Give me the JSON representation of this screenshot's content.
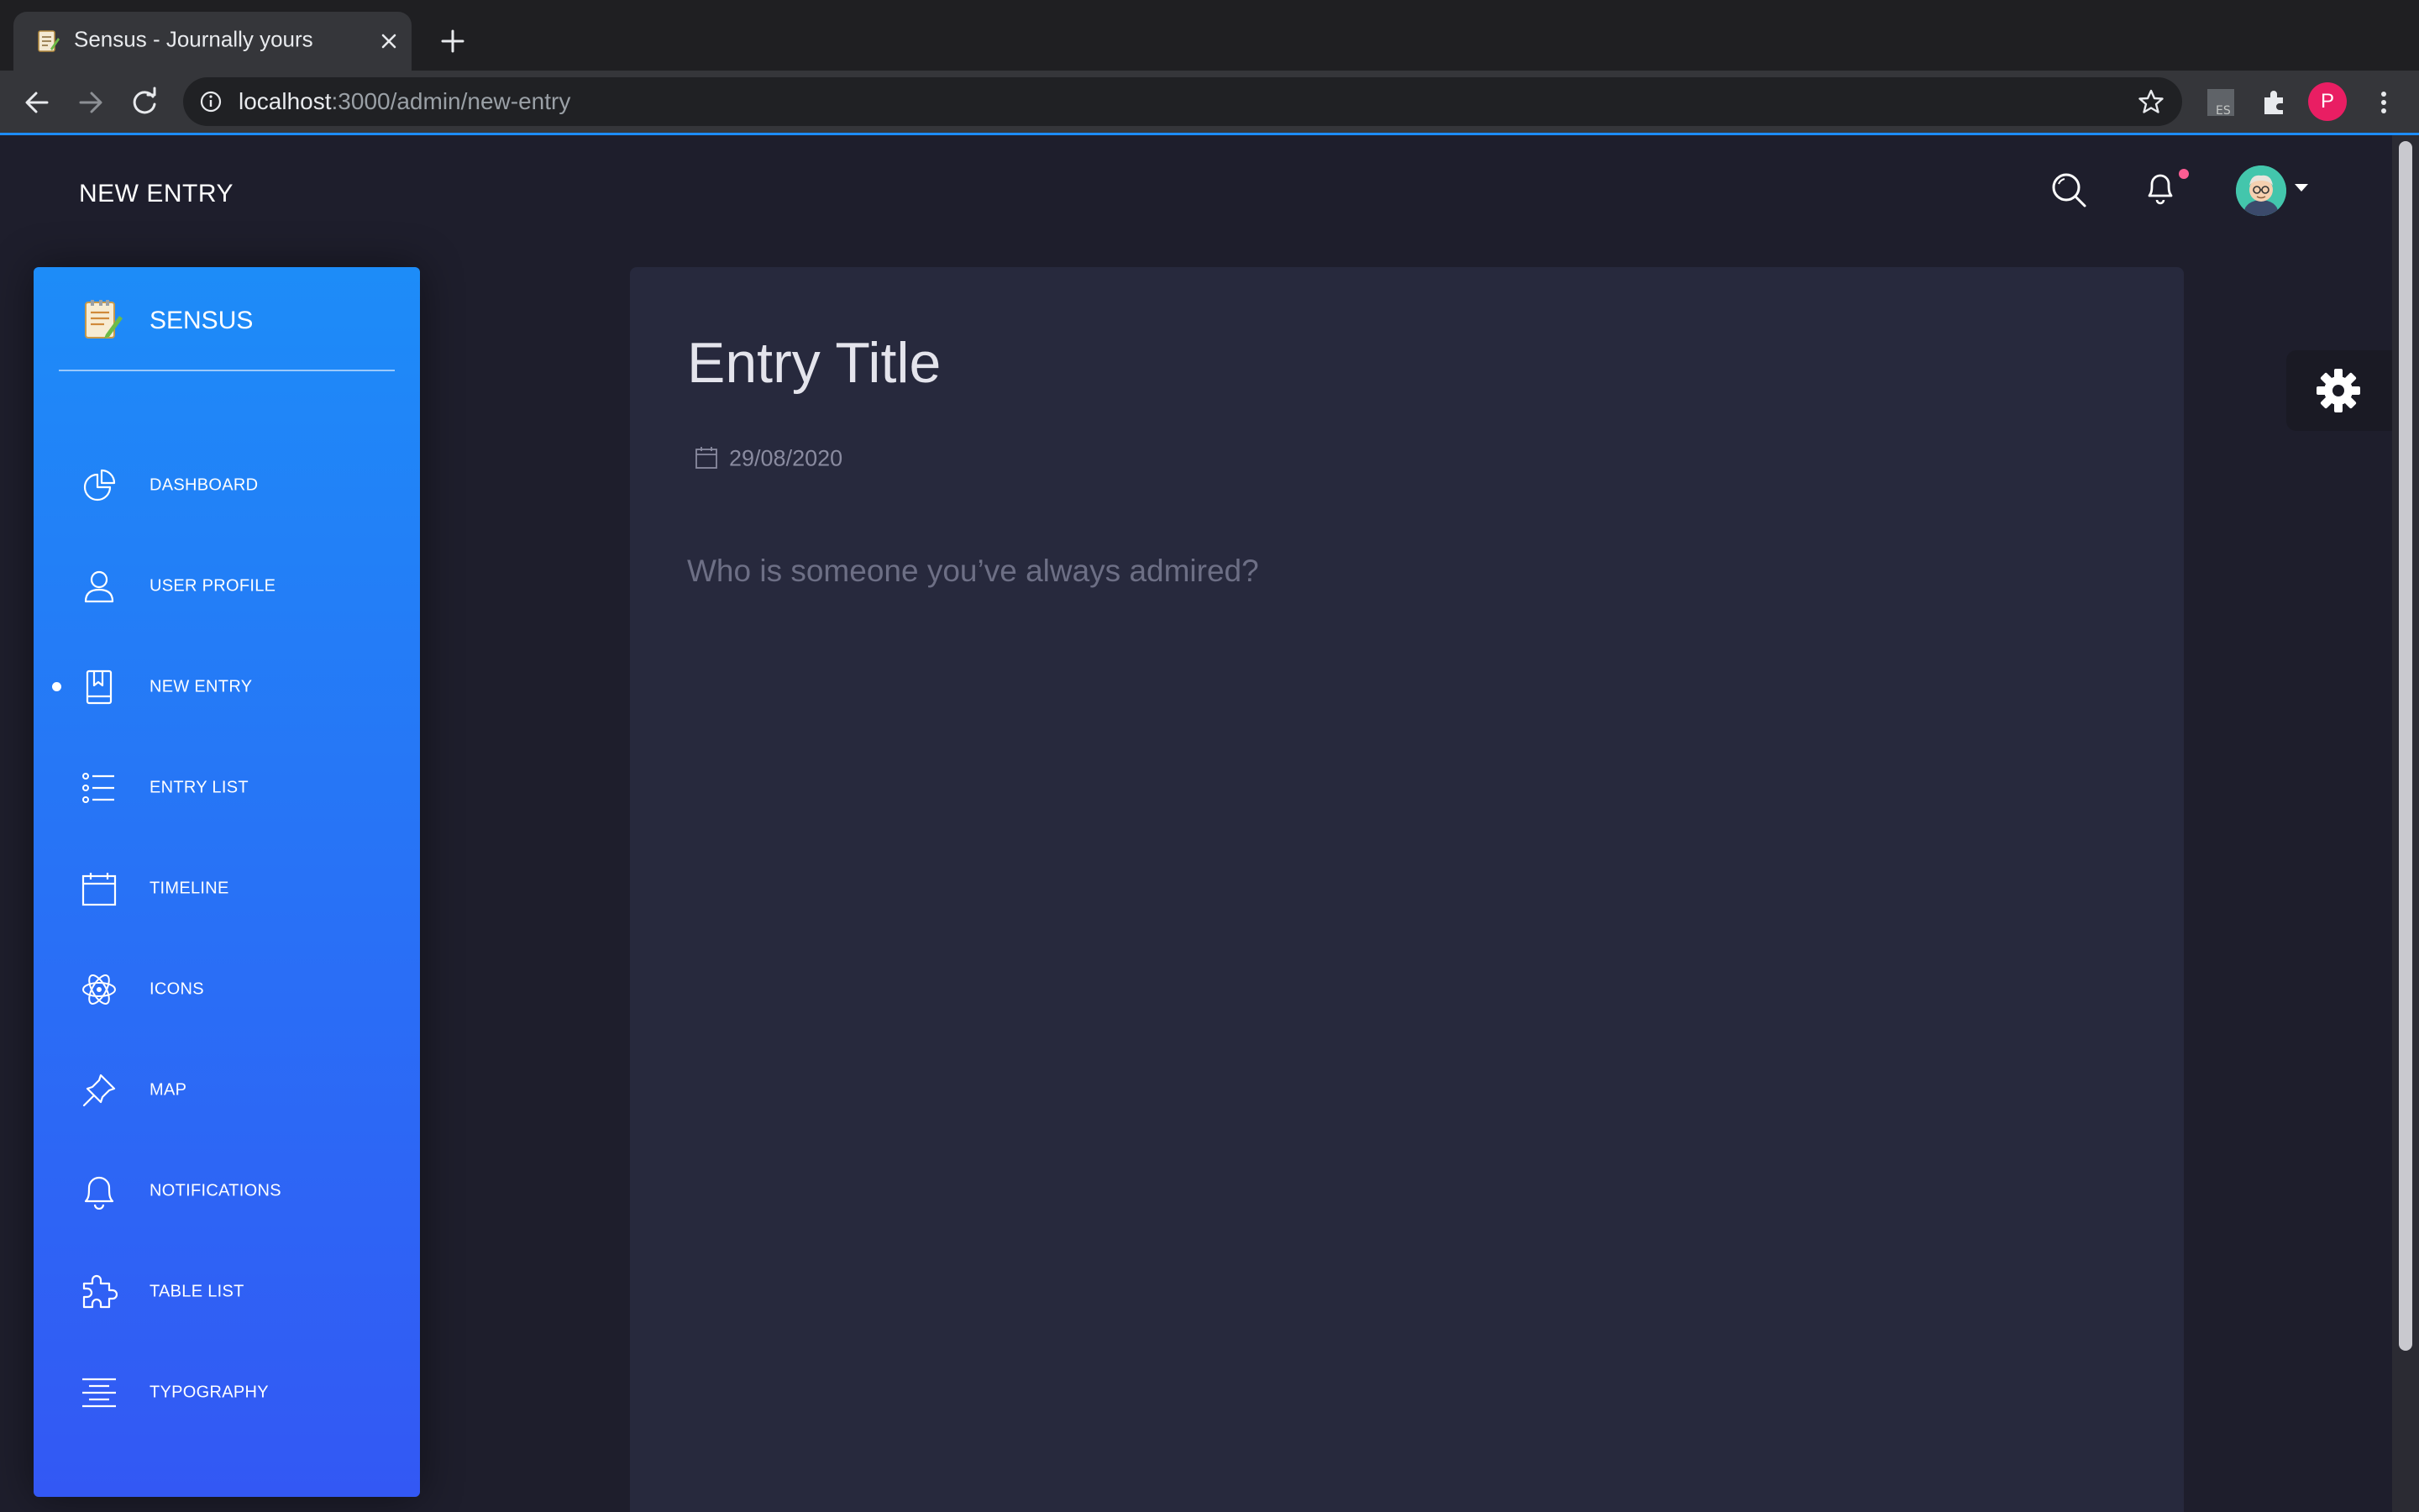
{
  "browser": {
    "tab_title": "Sensus - Journally yours",
    "url_host": "localhost",
    "url_path": ":3000/admin/new-entry",
    "profile_initial": "P"
  },
  "header": {
    "page_title": "NEW ENTRY"
  },
  "sidebar": {
    "brand": "SENSUS",
    "items": [
      {
        "label": "DASHBOARD",
        "icon": "pie-chart-icon"
      },
      {
        "label": "USER PROFILE",
        "icon": "user-icon"
      },
      {
        "label": "NEW ENTRY",
        "icon": "book-bookmark-icon",
        "active": true
      },
      {
        "label": "ENTRY LIST",
        "icon": "list-icon"
      },
      {
        "label": "TIMELINE",
        "icon": "calendar-icon"
      },
      {
        "label": "ICONS",
        "icon": "atom-icon"
      },
      {
        "label": "MAP",
        "icon": "pin-icon"
      },
      {
        "label": "NOTIFICATIONS",
        "icon": "bell-icon"
      },
      {
        "label": "TABLE LIST",
        "icon": "puzzle-icon"
      },
      {
        "label": "TYPOGRAPHY",
        "icon": "align-center-icon"
      }
    ]
  },
  "entry": {
    "title": "Entry Title",
    "date": "29/08/2020",
    "prompt": "Who is someone you’ve always admired?"
  },
  "colors": {
    "sidebar_top": "#1d8cf8",
    "sidebar_bottom": "#3358f4",
    "card_bg": "#27293d",
    "page_bg": "#1e1e2c",
    "notification_dot": "#fd5d93"
  }
}
